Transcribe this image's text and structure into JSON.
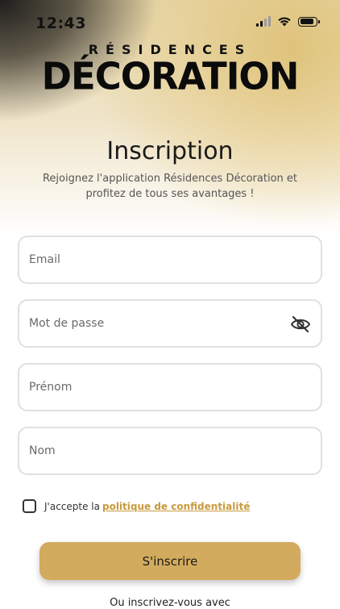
{
  "status_bar": {
    "time": "12:43"
  },
  "logo": {
    "top": "RÉSIDENCES",
    "main": "DÉCORATION"
  },
  "header": {
    "title": "Inscription",
    "subtitle": "Rejoignez l'application Résidences Décoration et profitez de tous ses avantages !"
  },
  "form": {
    "email_placeholder": "Email",
    "password_placeholder": "Mot de passe",
    "firstname_placeholder": "Prénom",
    "lastname_placeholder": "Nom",
    "consent_text": "J'accepte la",
    "policy_link": "politique de confidentialité",
    "submit_label": "S'inscrire",
    "alt_signup": "Ou inscrivez-vous avec"
  },
  "icons": {
    "password_toggle": "eye-slash-icon"
  },
  "colors": {
    "accent": "#d3ab5e",
    "link": "#c89a3e"
  }
}
